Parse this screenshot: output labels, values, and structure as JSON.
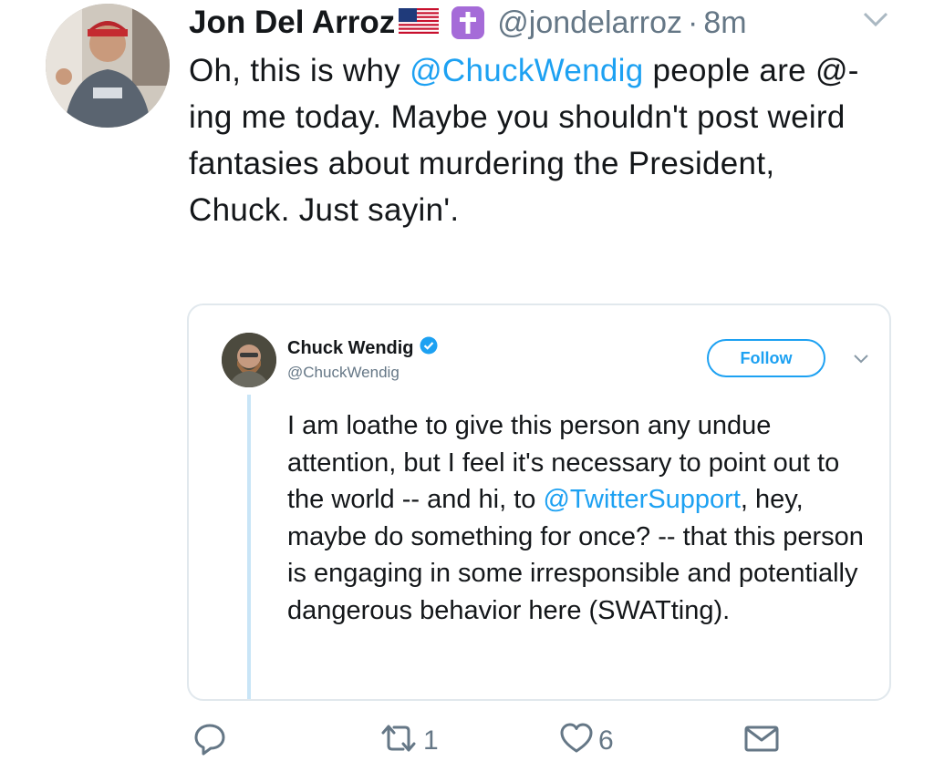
{
  "tweet": {
    "author": {
      "display_name": "Jon Del Arroz",
      "handle": "@jondelarroz",
      "badges": [
        "us-flag-icon",
        "cross-icon"
      ]
    },
    "separator": "·",
    "time": "8m",
    "text_parts": [
      "Oh, this is why ",
      "@ChuckWendig",
      " people are @-ing me today. Maybe you shouldn't post weird fantasies about murdering the President, Chuck. Just sayin'."
    ]
  },
  "quoted_tweet": {
    "author": {
      "display_name": "Chuck Wendig",
      "handle": "@ChuckWendig",
      "verified": true
    },
    "follow_label": "Follow",
    "text_parts": [
      "I am loathe to give this person any undue attention, but I feel it's necessary to point out to the world -- and hi, to ",
      "@TwitterSupport",
      ", hey, maybe do something for once? -- that this person is engaging in some irresponsible and potentially dangerous behavior here (SWATting)."
    ]
  },
  "actions": {
    "reply_count": "",
    "retweet_count": "1",
    "like_count": "6"
  },
  "colors": {
    "accent": "#1da1f2",
    "muted": "#657786",
    "text": "#14171a",
    "border": "#e1e8ed"
  }
}
